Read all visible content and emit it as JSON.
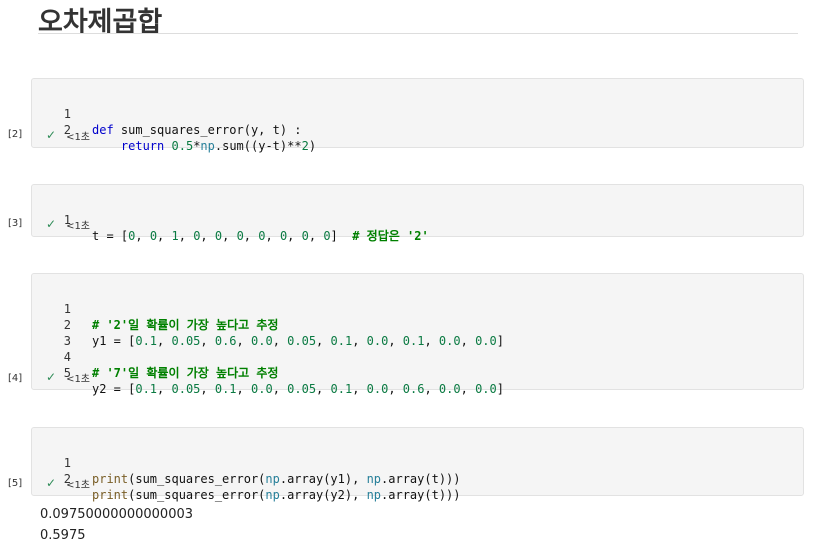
{
  "title": "오차제곱합",
  "cells": [
    {
      "exec_count": "[2]",
      "status_time": "<1초",
      "line_numbers": [
        "1",
        "2"
      ],
      "lines": [
        "def sum_squares_error(y, t) :",
        "    return 0.5*np.sum((y-t)**2)"
      ]
    },
    {
      "exec_count": "[3]",
      "status_time": "<1초",
      "line_numbers": [
        "1"
      ],
      "lines": [
        "t = [0, 0, 1, 0, 0, 0, 0, 0, 0, 0]  # 정답은 '2'"
      ]
    },
    {
      "exec_count": "[4]",
      "status_time": "<1초",
      "line_numbers": [
        "1",
        "2",
        "3",
        "4",
        "5"
      ],
      "lines": [
        "# '2'일 확률이 가장 높다고 추정",
        "y1 = [0.1, 0.05, 0.6, 0.0, 0.05, 0.1, 0.0, 0.1, 0.0, 0.0]",
        "",
        "# '7'일 확률이 가장 높다고 추정",
        "y2 = [0.1, 0.05, 0.1, 0.0, 0.05, 0.1, 0.0, 0.6, 0.0, 0.0]"
      ]
    },
    {
      "exec_count": "[5]",
      "status_time": "<1초",
      "line_numbers": [
        "1",
        "2"
      ],
      "lines": [
        "print(sum_squares_error(np.array(y1), np.array(t)))",
        "print(sum_squares_error(np.array(y2), np.array(t)))"
      ]
    }
  ],
  "output": [
    "0.09750000000000003",
    "0.5975"
  ],
  "icons": {
    "status": "check-icon"
  },
  "colors": {
    "keyword": "#0000cc",
    "number": "#0a7a42",
    "comment": "#008000",
    "check": "#2e8b57"
  }
}
